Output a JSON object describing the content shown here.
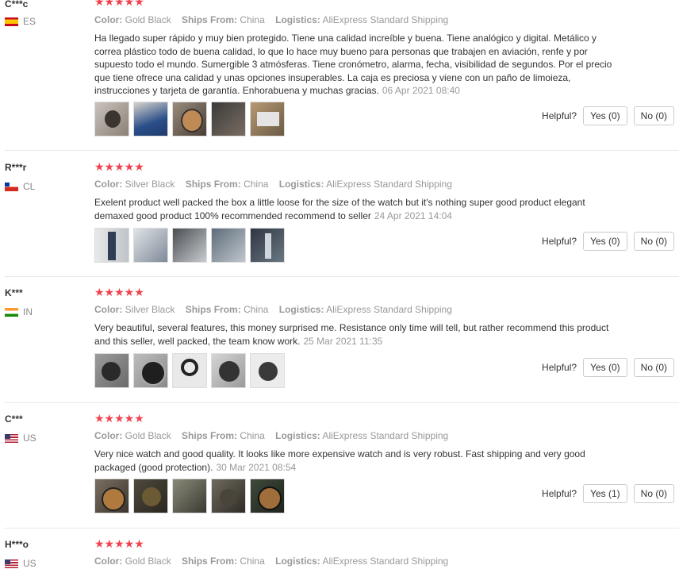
{
  "labels": {
    "color": "Color:",
    "ships_from": "Ships From:",
    "logistics": "Logistics:",
    "helpful": "Helpful?"
  },
  "colors": {
    "star": "#f0424e",
    "muted": "#999999"
  },
  "reviews": [
    {
      "user": "C***c",
      "country": "ES",
      "flag": "spain-flag-icon",
      "rating": 5,
      "stars": "★★★★★",
      "color_value": "Gold Black",
      "ships_from": "China",
      "logistics": "AliExpress Standard Shipping",
      "text": "Ha llegado super rápido y muy bien protegido. Tiene una calidad increíble y buena. Tiene analógico y digital. Metálico y correa plástico todo de buena calidad, lo que lo hace muy bueno para personas que trabajen en aviación, renfe y por supuesto todo el mundo. Sumergible 3 atmósferas. Tiene cronómetro, alarma, fecha, visibilidad de segundos. Por el precio que tiene ofrece una calidad y unas opciones insuperables. La caja es preciosa y viene con un paño de limoieza, instrucciones y tarjeta de garantía. Enhorabuena y muchas gracias.",
      "date": "06 Apr 2021 08:40",
      "yes": "Yes (0)",
      "no": "No (0)"
    },
    {
      "user": "R***r",
      "country": "CL",
      "flag": "chile-flag-icon",
      "rating": 5,
      "stars": "★★★★★",
      "color_value": "Silver Black",
      "ships_from": "China",
      "logistics": "AliExpress Standard Shipping",
      "text": "Exelent product well packed the box a little loose for the size of the watch but it's nothing super good product elegant demaxed good product 100% recommended recommend to seller",
      "date": "24 Apr 2021 14:04",
      "yes": "Yes (0)",
      "no": "No (0)"
    },
    {
      "user": "K***",
      "country": "IN",
      "flag": "india-flag-icon",
      "rating": 5,
      "stars": "★★★★★",
      "color_value": "Silver Black",
      "ships_from": "China",
      "logistics": "AliExpress Standard Shipping",
      "text": "Very beautiful, several features, this money surprised me. Resistance only time will tell, but rather recommend this product and this seller, well packed, the team know work.",
      "date": "25 Mar 2021 11:35",
      "yes": "Yes (0)",
      "no": "No (0)"
    },
    {
      "user": "C***",
      "country": "US",
      "flag": "usa-flag-icon",
      "rating": 5,
      "stars": "★★★★★",
      "color_value": "Gold Black",
      "ships_from": "China",
      "logistics": "AliExpress Standard Shipping",
      "text": "Very nice watch and good quality. It looks like more expensive watch and is very robust. Fast shipping and very good packaged (good protection).",
      "date": "30 Mar 2021 08:54",
      "yes": "Yes (1)",
      "no": "No (0)"
    },
    {
      "user": "H***o",
      "country": "US",
      "flag": "usa-flag-icon",
      "rating": 5,
      "stars": "★★★★★",
      "color_value": "Gold Black",
      "ships_from": "China",
      "logistics": "AliExpress Standard Shipping"
    }
  ]
}
